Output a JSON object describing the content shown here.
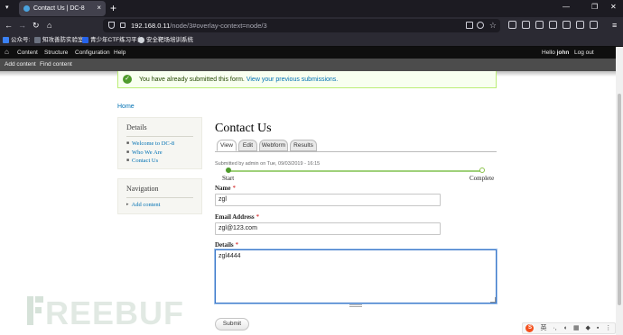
{
  "browser": {
    "tab": {
      "title": "Contact Us | DC-8"
    },
    "url": {
      "host": "192.168.0.11",
      "path": "/node/3#overlay-context=node/3"
    },
    "bookmarks": [
      {
        "label": "公众号:",
        "color": "#3b82f6"
      },
      {
        "label": "知攻善防实验室",
        "color": "#6b7280"
      },
      {
        "label": "青少年CTF练习平台",
        "color": "#2563eb"
      },
      {
        "label": "安全靶场培训系统",
        "color": "#d1d5db"
      }
    ]
  },
  "toolbar": {
    "items": [
      "Content",
      "Structure",
      "Configuration",
      "Help"
    ],
    "greeting": "Hello",
    "user": "john",
    "logout": "Log out",
    "shortcuts": [
      "Add content",
      "Find content"
    ]
  },
  "status": {
    "message": "You have already submitted this form.",
    "link": "View your previous submissions."
  },
  "breadcrumb": "Home",
  "sidebar": {
    "details": {
      "title": "Details",
      "links": [
        "Welcome to DC-8",
        "Who We Are",
        "Contact Us"
      ]
    },
    "navigation": {
      "title": "Navigation",
      "links": [
        "Add content"
      ]
    }
  },
  "page": {
    "title": "Contact Us",
    "tabs": [
      "View",
      "Edit",
      "Webform",
      "Results"
    ],
    "active_tab": "View",
    "submitted": "Submitted by admin on Tue, 09/03/2019 - 16:15",
    "progress": {
      "start": "Start",
      "end": "Complete"
    }
  },
  "form": {
    "name": {
      "label": "Name",
      "required": "*",
      "value": "zgl"
    },
    "email": {
      "label": "Email Address",
      "required": "*",
      "value": "zgl@123.com"
    },
    "details": {
      "label": "Details",
      "required": "*",
      "value": "zgl4444"
    },
    "submit": "Submit"
  },
  "watermark": "REEBUF",
  "ime": {
    "logo": "S",
    "lang": "英"
  }
}
